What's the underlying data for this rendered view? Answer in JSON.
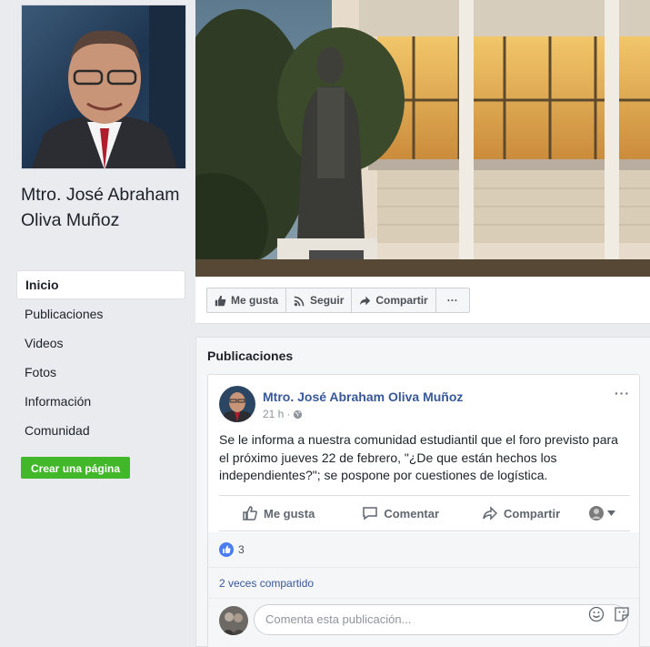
{
  "page": {
    "name": "Mtro. José Abraham Oliva Muñoz"
  },
  "nav": {
    "items": [
      "Inicio",
      "Publicaciones",
      "Videos",
      "Fotos",
      "Información",
      "Comunidad"
    ],
    "active": "Inicio"
  },
  "create_page_label": "Crear una página",
  "actions": {
    "like": "Me gusta",
    "follow": "Seguir",
    "share": "Compartir",
    "more": "···"
  },
  "posts_section": {
    "title": "Publicaciones"
  },
  "post": {
    "author": "Mtro. José Abraham Oliva Muñoz",
    "time": "21 h",
    "separator": "·",
    "text": "Se le informa a nuestra comunidad estudiantil que el foro previsto para el próximo jueves 22 de febrero, \"¿De que están hechos los independientes?\"; se pospone por cuestiones de logística.",
    "like_label": "Me gusta",
    "comment_label": "Comentar",
    "share_label": "Compartir",
    "more": "···",
    "reaction_count": "3",
    "shares_text": "2 veces compartido",
    "comment_placeholder": "Comenta esta publicación..."
  },
  "colors": {
    "link": "#385898",
    "green": "#42b72a",
    "background": "#e9ebee"
  }
}
